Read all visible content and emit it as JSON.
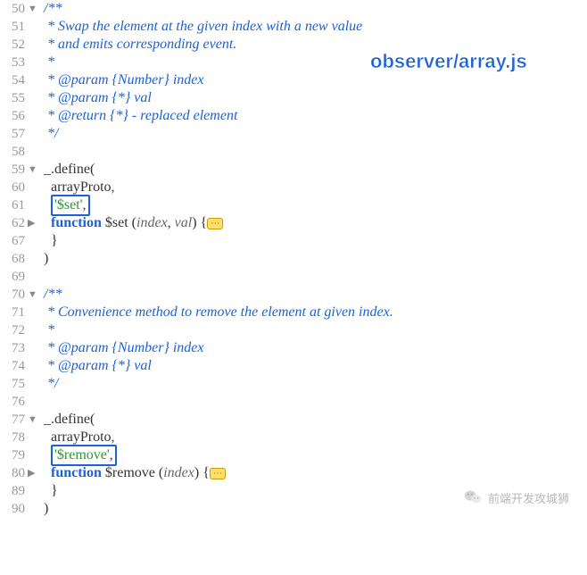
{
  "overlay": {
    "file_label": "observer/array.js"
  },
  "watermark": {
    "text": "前端开发攻城狮"
  },
  "fold_marker": "⋯",
  "lines": [
    {
      "num": "50",
      "fold": "▼",
      "indent": "",
      "tokens": [
        {
          "cls": "comment",
          "t": "/**"
        }
      ]
    },
    {
      "num": "51",
      "fold": "",
      "indent": " ",
      "tokens": [
        {
          "cls": "comment",
          "t": "* Swap the element at the given index with a new value"
        }
      ]
    },
    {
      "num": "52",
      "fold": "",
      "indent": " ",
      "tokens": [
        {
          "cls": "comment",
          "t": "* and emits corresponding event."
        }
      ]
    },
    {
      "num": "53",
      "fold": "",
      "indent": " ",
      "tokens": [
        {
          "cls": "comment",
          "t": "*"
        }
      ]
    },
    {
      "num": "54",
      "fold": "",
      "indent": " ",
      "tokens": [
        {
          "cls": "comment",
          "t": "* @param {Number} index"
        }
      ]
    },
    {
      "num": "55",
      "fold": "",
      "indent": " ",
      "tokens": [
        {
          "cls": "comment",
          "t": "* @param {*} val"
        }
      ]
    },
    {
      "num": "56",
      "fold": "",
      "indent": " ",
      "tokens": [
        {
          "cls": "comment",
          "t": "* @return {*} - replaced element"
        }
      ]
    },
    {
      "num": "57",
      "fold": "",
      "indent": " ",
      "tokens": [
        {
          "cls": "comment",
          "t": "*/"
        }
      ]
    },
    {
      "num": "58",
      "fold": "",
      "indent": "",
      "tokens": []
    },
    {
      "num": "59",
      "fold": "▼",
      "indent": "",
      "tokens": [
        {
          "cls": "ident",
          "t": "_.define("
        }
      ]
    },
    {
      "num": "60",
      "fold": "",
      "indent": "  ",
      "tokens": [
        {
          "cls": "ident",
          "t": "arrayProto"
        },
        {
          "cls": "punct",
          "t": ","
        }
      ]
    },
    {
      "num": "61",
      "fold": "",
      "indent": "  ",
      "box": true,
      "tokens": [
        {
          "cls": "string",
          "t": "'$set'"
        },
        {
          "cls": "punct",
          "t": ","
        }
      ]
    },
    {
      "num": "62",
      "fold": "▶",
      "indent": "  ",
      "folded": true,
      "tokens": [
        {
          "cls": "keyword",
          "t": "function"
        },
        {
          "cls": "",
          "t": " "
        },
        {
          "cls": "ident",
          "t": "$set ("
        },
        {
          "cls": "param-i",
          "t": "index"
        },
        {
          "cls": "punct",
          "t": ", "
        },
        {
          "cls": "param-i",
          "t": "val"
        },
        {
          "cls": "ident",
          "t": ") {"
        }
      ]
    },
    {
      "num": "67",
      "fold": "",
      "indent": "  ",
      "tokens": [
        {
          "cls": "ident",
          "t": "}"
        }
      ]
    },
    {
      "num": "68",
      "fold": "",
      "indent": "",
      "tokens": [
        {
          "cls": "ident",
          "t": ")"
        }
      ]
    },
    {
      "num": "69",
      "fold": "",
      "indent": "",
      "tokens": []
    },
    {
      "num": "70",
      "fold": "▼",
      "indent": "",
      "tokens": [
        {
          "cls": "comment",
          "t": "/**"
        }
      ]
    },
    {
      "num": "71",
      "fold": "",
      "indent": " ",
      "tokens": [
        {
          "cls": "comment",
          "t": "* Convenience method to remove the element at given index."
        }
      ]
    },
    {
      "num": "72",
      "fold": "",
      "indent": " ",
      "tokens": [
        {
          "cls": "comment",
          "t": "*"
        }
      ]
    },
    {
      "num": "73",
      "fold": "",
      "indent": " ",
      "tokens": [
        {
          "cls": "comment",
          "t": "* @param {Number} index"
        }
      ]
    },
    {
      "num": "74",
      "fold": "",
      "indent": " ",
      "tokens": [
        {
          "cls": "comment",
          "t": "* @param {*} val"
        }
      ]
    },
    {
      "num": "75",
      "fold": "",
      "indent": " ",
      "tokens": [
        {
          "cls": "comment",
          "t": "*/"
        }
      ]
    },
    {
      "num": "76",
      "fold": "",
      "indent": "",
      "tokens": []
    },
    {
      "num": "77",
      "fold": "▼",
      "indent": "",
      "tokens": [
        {
          "cls": "ident",
          "t": "_.define("
        }
      ]
    },
    {
      "num": "78",
      "fold": "",
      "indent": "  ",
      "tokens": [
        {
          "cls": "ident",
          "t": "arrayProto"
        },
        {
          "cls": "punct",
          "t": ","
        }
      ]
    },
    {
      "num": "79",
      "fold": "",
      "indent": "  ",
      "box": true,
      "tokens": [
        {
          "cls": "string",
          "t": "'$remove'"
        },
        {
          "cls": "punct",
          "t": ","
        }
      ]
    },
    {
      "num": "80",
      "fold": "▶",
      "indent": "  ",
      "folded": true,
      "tokens": [
        {
          "cls": "keyword",
          "t": "function"
        },
        {
          "cls": "",
          "t": " "
        },
        {
          "cls": "ident",
          "t": "$remove ("
        },
        {
          "cls": "param-i",
          "t": "index"
        },
        {
          "cls": "ident",
          "t": ") {"
        }
      ]
    },
    {
      "num": "89",
      "fold": "",
      "indent": "  ",
      "tokens": [
        {
          "cls": "ident",
          "t": "}"
        }
      ]
    },
    {
      "num": "90",
      "fold": "",
      "indent": "",
      "tokens": [
        {
          "cls": "ident",
          "t": ")"
        }
      ]
    }
  ]
}
